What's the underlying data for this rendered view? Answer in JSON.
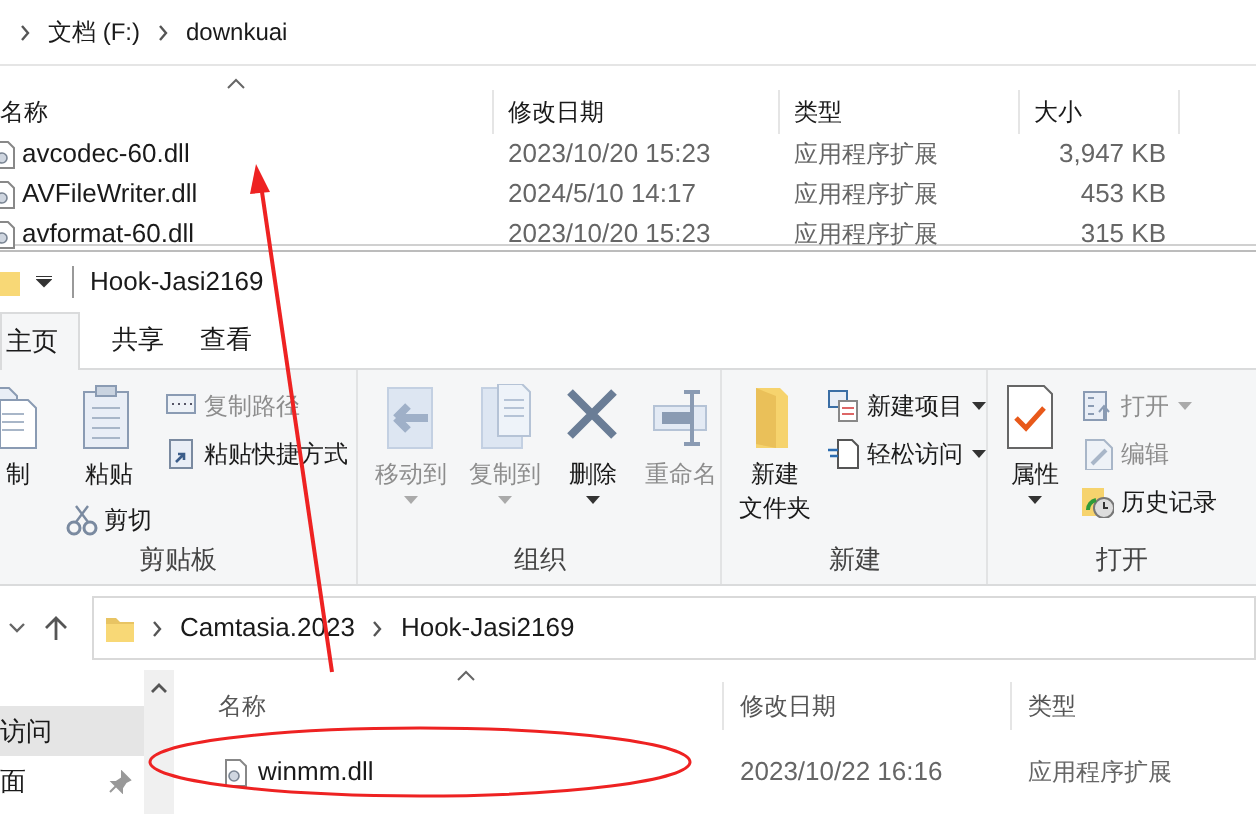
{
  "back_window": {
    "breadcrumb": [
      "文档 (F:)",
      "downkuai"
    ],
    "columns": [
      "名称",
      "修改日期",
      "类型",
      "大小"
    ],
    "rows": [
      {
        "name": "avcodec-60.dll",
        "date": "2023/10/20 15:23",
        "type": "应用程序扩展",
        "size": "3,947 KB"
      },
      {
        "name": "AVFileWriter.dll",
        "date": "2024/5/10 14:17",
        "type": "应用程序扩展",
        "size": "453 KB"
      },
      {
        "name": "avformat-60.dll",
        "date": "2023/10/20 15:23",
        "type": "应用程序扩展",
        "size": "315 KB"
      }
    ]
  },
  "window": {
    "title": "Hook-Jasi2169",
    "tabs": [
      {
        "label": "主页",
        "selected": true
      },
      {
        "label": "共享",
        "selected": false
      },
      {
        "label": "查看",
        "selected": false
      }
    ],
    "ribbon": [
      {
        "label": "剪贴板",
        "columns": [
          [
            {
              "label": "制",
              "kind": "large",
              "disabled": false,
              "dropdown": false
            }
          ],
          [
            {
              "label": "粘贴",
              "kind": "large",
              "disabled": false,
              "dropdown": false
            },
            {
              "label": "剪切",
              "kind": "small",
              "disabled": false,
              "dropdown": false
            }
          ],
          [
            {
              "label": "复制路径",
              "kind": "small",
              "disabled": true,
              "dropdown": false
            },
            {
              "label": "粘贴快捷方式",
              "kind": "small",
              "disabled": false,
              "dropdown": false
            }
          ]
        ]
      },
      {
        "label": "组织",
        "columns": [
          [
            {
              "label": "移动到",
              "kind": "large",
              "disabled": true,
              "dropdown": true
            }
          ],
          [
            {
              "label": "复制到",
              "kind": "large",
              "disabled": true,
              "dropdown": true
            }
          ],
          [
            {
              "label": "删除",
              "kind": "large",
              "disabled": false,
              "dropdown": true
            }
          ],
          [
            {
              "label": "重命名",
              "kind": "large",
              "disabled": true,
              "dropdown": false
            }
          ]
        ]
      },
      {
        "label": "新建",
        "columns": [
          [
            {
              "label": "新建",
              "sublabel": "文件夹",
              "kind": "large",
              "disabled": false,
              "dropdown": false
            }
          ],
          [
            {
              "label": "新建项目",
              "kind": "small",
              "disabled": false,
              "dropdown": true
            },
            {
              "label": "轻松访问",
              "kind": "small",
              "disabled": false,
              "dropdown": true
            }
          ]
        ]
      },
      {
        "label": "打开",
        "columns": [
          [
            {
              "label": "属性",
              "kind": "large",
              "disabled": false,
              "dropdown": true
            }
          ],
          [
            {
              "label": "打开",
              "kind": "small",
              "disabled": true,
              "dropdown": true
            },
            {
              "label": "编辑",
              "kind": "small",
              "disabled": true,
              "dropdown": false
            },
            {
              "label": "历史记录",
              "kind": "small",
              "disabled": false,
              "dropdown": false
            }
          ]
        ]
      }
    ],
    "address": [
      "Camtasia.2023",
      "Hook-Jasi2169"
    ],
    "nav": [
      {
        "label": "访问",
        "selected": true,
        "pinned": false
      },
      {
        "label": "面",
        "selected": false,
        "pinned": true
      }
    ],
    "columns": [
      "名称",
      "修改日期",
      "类型"
    ],
    "rows": [
      {
        "name": "winmm.dll",
        "date": "2023/10/22 16:16",
        "type": "应用程序扩展"
      }
    ]
  }
}
